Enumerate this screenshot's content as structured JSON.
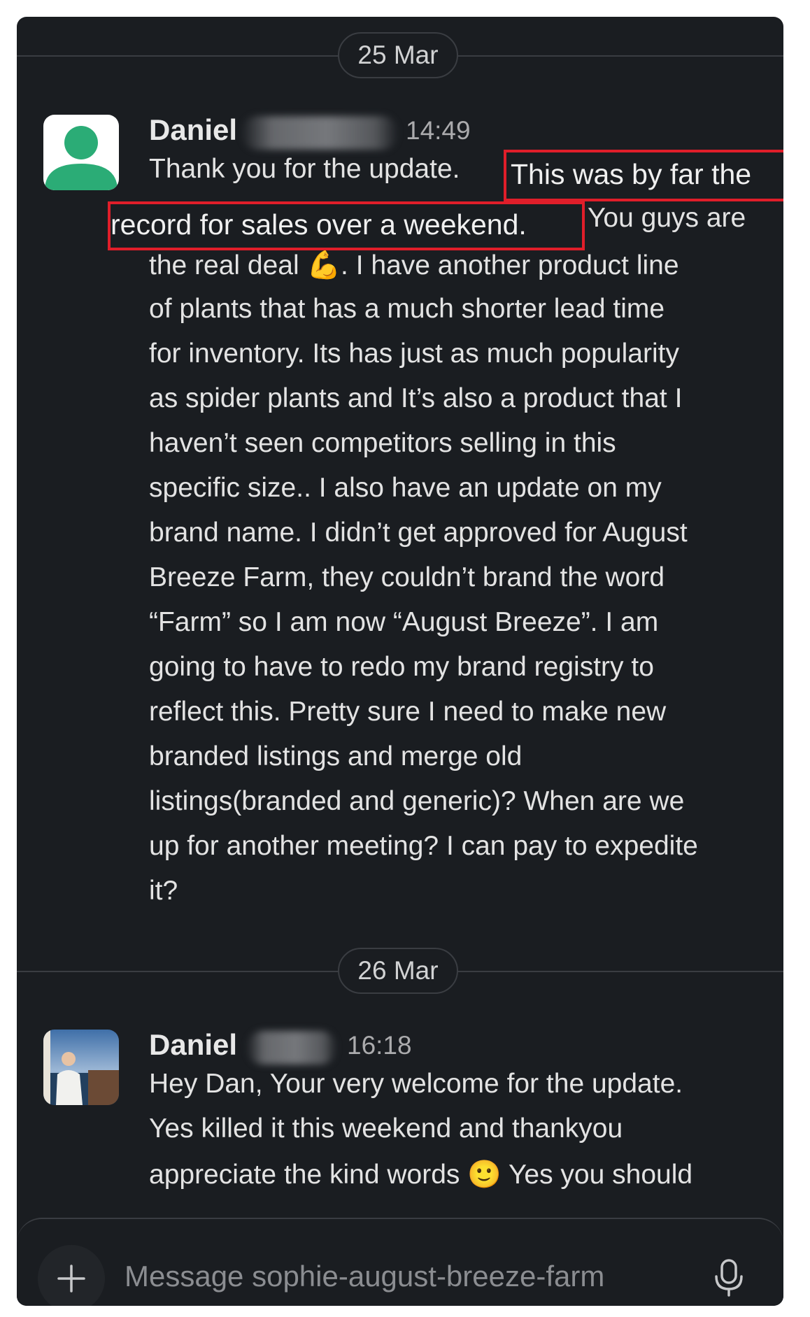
{
  "messages": [
    {
      "date": "25 Mar",
      "author": "Daniel",
      "time": "14:49",
      "avatar": "generic-user-avatar",
      "lines": [
        "Thank you for the update.",
        "This was by far the",
        "record for sales over a weekend.",
        "You guys are",
        "the real deal 💪. I have another product line",
        "of plants that has a much shorter lead time",
        "for inventory. Its has just as much popularity",
        "as spider plants and It’s also a product that I",
        "haven’t seen competitors selling in this",
        "specific size.. I also have an update on my",
        "brand name. I didn’t get approved for August",
        "Breeze Farm, they couldn’t brand the word",
        "“Farm” so I am now “August Breeze”. I am",
        "going to have to redo my brand registry to",
        "reflect this. Pretty sure I need to make new",
        "branded listings and merge old",
        "listings(branded and generic)? When are we",
        "up for another meeting? I can pay to expedite",
        "it?"
      ]
    },
    {
      "date": "26 Mar",
      "author": "Daniel",
      "time": "16:18",
      "avatar": "profile-photo",
      "lines": [
        "Hey Dan, Your very welcome for the update.",
        "Yes killed it this weekend and thankyou",
        "appreciate the kind words 🙂 Yes you should"
      ]
    }
  ],
  "composer": {
    "placeholder": "Message sophie-august-breeze-farm"
  },
  "colors": {
    "background": "#1a1d21",
    "highlight_border": "#e01e2a",
    "text": "#e3e3e3"
  }
}
